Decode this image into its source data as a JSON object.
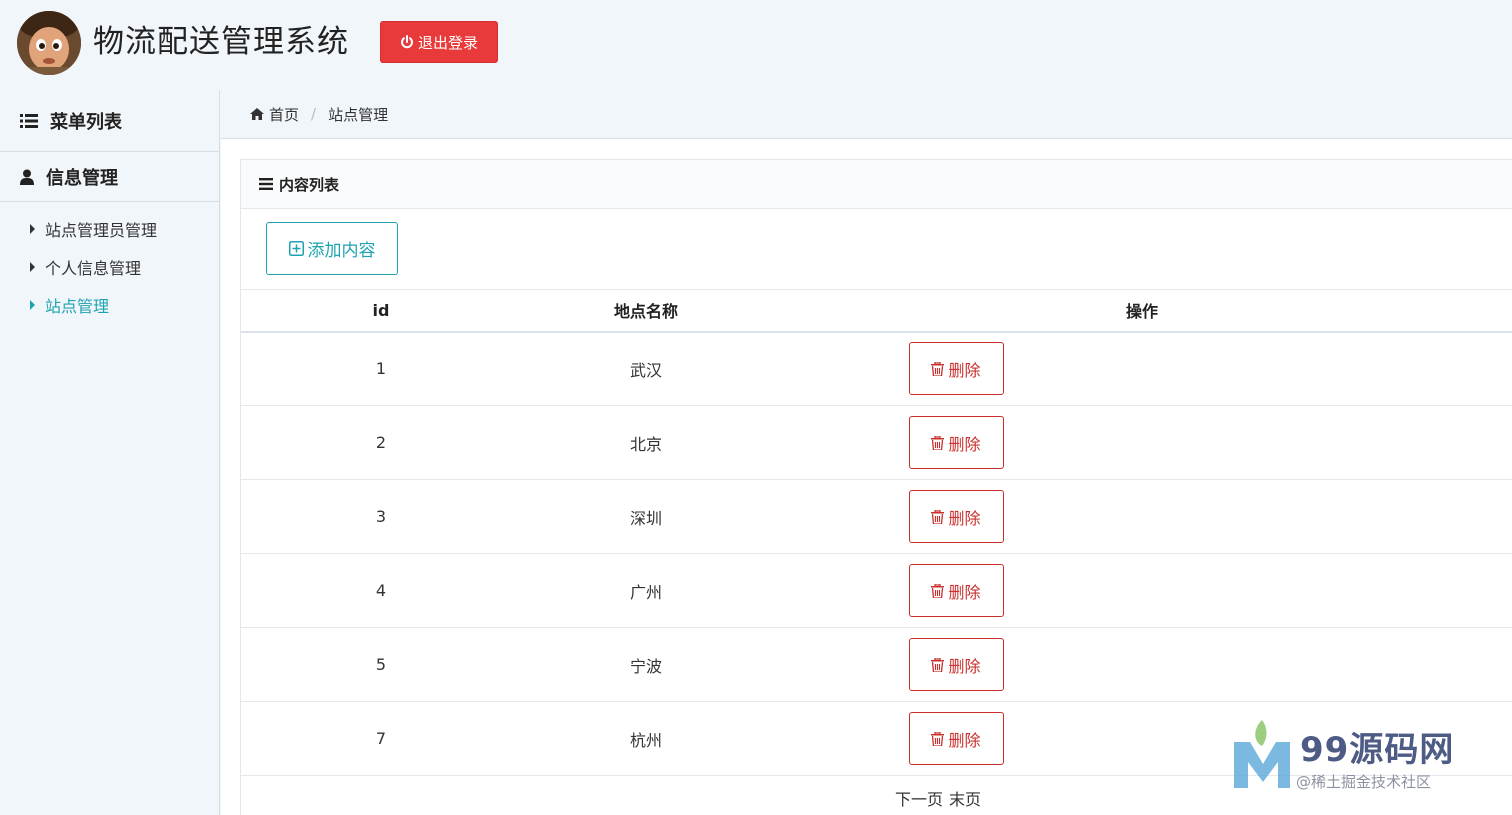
{
  "header": {
    "title": "物流配送管理系统",
    "logout_label": "退出登录"
  },
  "sidebar": {
    "menu_title": "菜单列表",
    "group_title": "信息管理",
    "items": [
      {
        "label": "站点管理员管理",
        "active": false
      },
      {
        "label": "个人信息管理",
        "active": false
      },
      {
        "label": "站点管理",
        "active": true
      }
    ]
  },
  "breadcrumb": {
    "home": "首页",
    "current": "站点管理"
  },
  "content": {
    "panel_title": "内容列表",
    "add_label": "添加内容",
    "columns": [
      "id",
      "地点名称",
      "操作"
    ],
    "delete_label": "删除",
    "rows": [
      {
        "id": "1",
        "name": "武汉"
      },
      {
        "id": "2",
        "name": "北京"
      },
      {
        "id": "3",
        "name": "深圳"
      },
      {
        "id": "4",
        "name": "广州"
      },
      {
        "id": "5",
        "name": "宁波"
      },
      {
        "id": "7",
        "name": "杭州"
      }
    ],
    "pager": {
      "next": "下一页",
      "last": "末页"
    }
  },
  "watermark": {
    "brand": "99源码网",
    "sub": "@稀土掘金技术社区"
  },
  "colors": {
    "accent": "#1fa3b2",
    "danger": "#e83a3a",
    "delete_border": "#c9302c",
    "background": "#f1f6fb"
  }
}
